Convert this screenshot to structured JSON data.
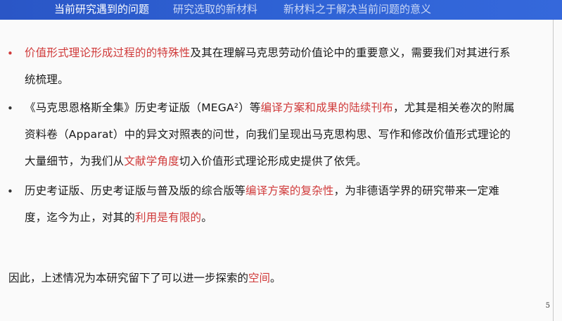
{
  "header": {
    "tabs": [
      {
        "label": "当前研究遇到的问题",
        "active": true
      },
      {
        "label": "研究选取的新材料",
        "active": false
      },
      {
        "label": "新材料之于解决当前问题的意义",
        "active": false
      }
    ]
  },
  "bullets": [
    {
      "bullet_glyph": "•",
      "segments": [
        {
          "text": "价值形式理论形成过程的的特殊性",
          "highlight": true
        },
        {
          "text": "及其在理解马克思劳动价值论中的重要意义，需要我们对其进行系统梳理。",
          "highlight": false
        }
      ]
    },
    {
      "bullet_glyph": "•",
      "segments": [
        {
          "text": "《马克思恩格斯全集》历史考证版（MEGA²）等",
          "highlight": false
        },
        {
          "text": "编译方案和成果的陆续刊布",
          "highlight": true
        },
        {
          "text": "，尤其是相关卷次的附属资料卷（Apparat）中的异文对照表的问世，向我们呈现出马克思构思、写作和修改价值形式理论的大量细节，为我们从",
          "highlight": false
        },
        {
          "text": "文献学角度",
          "highlight": true
        },
        {
          "text": "切入价值形式理论形成史提供了依凭。",
          "highlight": false
        }
      ]
    },
    {
      "bullet_glyph": "•",
      "segments": [
        {
          "text": "历史考证版、历史考证版与普及版的综合版等",
          "highlight": false
        },
        {
          "text": "编译方案的复杂性",
          "highlight": true
        },
        {
          "text": "，为非德语学界的研究带来一定难度，迄今为止，对其的",
          "highlight": false
        },
        {
          "text": "利用是有限的",
          "highlight": true
        },
        {
          "text": "。",
          "highlight": false
        }
      ]
    }
  ],
  "conclusion": {
    "segments": [
      {
        "text": "因此，上述情况为本研究留下了可以进一步探索的",
        "highlight": false
      },
      {
        "text": "空间",
        "highlight": true
      },
      {
        "text": "。",
        "highlight": false
      }
    ]
  },
  "page_number": "5",
  "colors": {
    "header_bg": "#2f63d6",
    "highlight": "#d03a3a",
    "text": "#1a1a1a"
  }
}
